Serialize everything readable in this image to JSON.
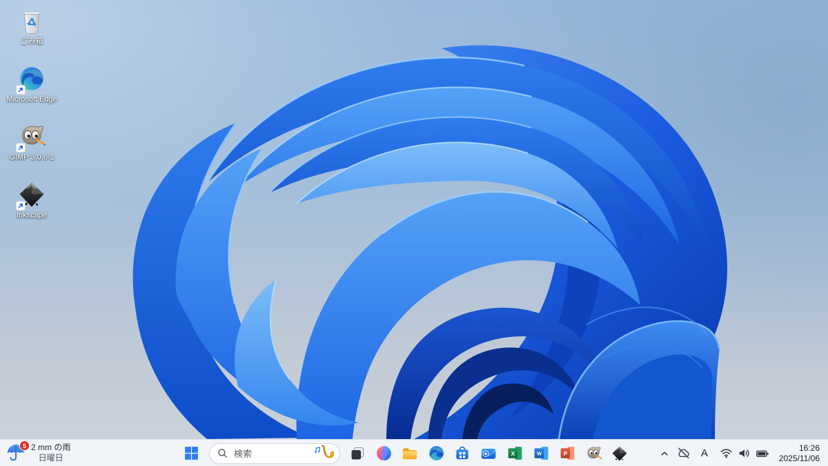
{
  "desktop": {
    "icons": [
      {
        "id": "recycle-bin",
        "label": "ごみ箱"
      },
      {
        "id": "microsoft-edge",
        "label": "Microsoft Edge"
      },
      {
        "id": "gimp",
        "label": "GIMP 3.0.6-1"
      },
      {
        "id": "inkscape",
        "label": "Inkscape"
      }
    ]
  },
  "taskbar": {
    "widgets": {
      "badge": "5",
      "line1": "2 mm の雨",
      "line2": "日曜日"
    },
    "search": {
      "placeholder": "検索"
    },
    "pinned_apps": [
      "task-view",
      "copilot",
      "file-explorer",
      "microsoft-edge",
      "microsoft-store",
      "outlook",
      "excel",
      "word",
      "powerpoint",
      "gimp",
      "inkscape"
    ],
    "office_letters": {
      "excel": "X",
      "word": "W",
      "powerpoint": "P"
    },
    "tray": {
      "ime_mode": "A",
      "time": "16:26",
      "date": "2025/11/06"
    }
  },
  "colors": {
    "accent_blue": "#1f6af0",
    "taskbar_bg": "#f2f5fa",
    "badge_red": "#d93025",
    "wallpaper_sky": "#9ab9dc",
    "wallpaper_gray": "#ccd3db",
    "bloom_deep_blue": "#0a3fb8",
    "bloom_light_blue": "#7cbdf9"
  }
}
